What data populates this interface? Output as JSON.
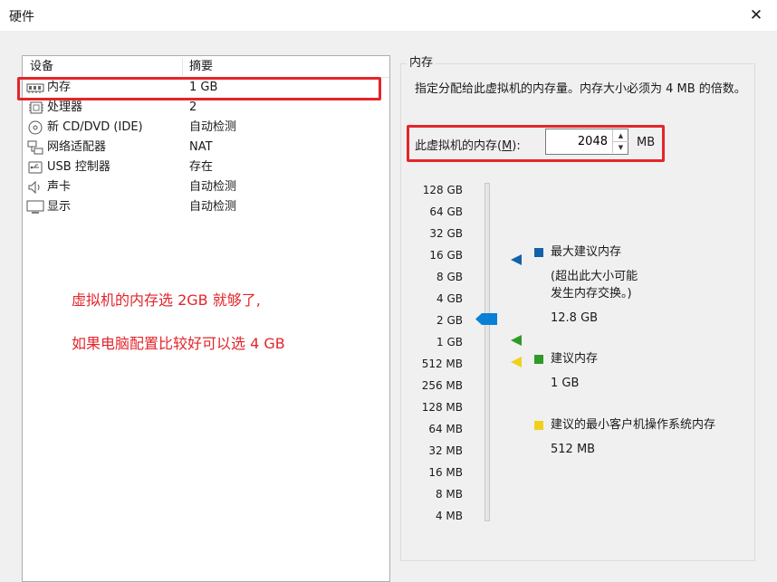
{
  "window": {
    "title": "硬件",
    "close_glyph": "✕"
  },
  "device_list": {
    "col_device": "设备",
    "col_summary": "摘要",
    "rows": [
      {
        "name": "内存",
        "summary": "1 GB",
        "icon": "memory-icon"
      },
      {
        "name": "处理器",
        "summary": "2",
        "icon": "processor-icon"
      },
      {
        "name": "新 CD/DVD (IDE)",
        "summary": "自动检测",
        "icon": "cd-dvd-icon"
      },
      {
        "name": "网络适配器",
        "summary": "NAT",
        "icon": "network-adapter-icon"
      },
      {
        "name": "USB 控制器",
        "summary": "存在",
        "icon": "usb-icon"
      },
      {
        "name": "声卡",
        "summary": "自动检测",
        "icon": "sound-card-icon"
      },
      {
        "name": "显示",
        "summary": "自动检测",
        "icon": "display-icon"
      }
    ]
  },
  "annotations": {
    "line1": "虚拟机的内存选 2GB 就够了,",
    "line2": "如果电脑配置比较好可以选 4 GB"
  },
  "memory": {
    "group_title": "内存",
    "description": "指定分配给此虚拟机的内存量。内存大小必须为 4 MB 的倍数。",
    "label_prefix": "此虚拟机的内存(",
    "label_hotkey": "M",
    "label_suffix": "):",
    "value": "2048",
    "unit": "MB",
    "scale": [
      "128 GB",
      "64 GB",
      "32 GB",
      "16 GB",
      "8 GB",
      "4 GB",
      "2 GB",
      "1 GB",
      "512 MB",
      "256 MB",
      "128 MB",
      "64 MB",
      "32 MB",
      "16 MB",
      "8 MB",
      "4 MB"
    ],
    "slider_value": "2 GB",
    "legend": {
      "max_title": "最大建议内存",
      "max_note_1": "(超出此大小可能",
      "max_note_2": "发生内存交换。)",
      "max_value": "12.8 GB",
      "rec_title": "建议内存",
      "rec_value": "1 GB",
      "min_title": "建议的最小客户机操作系统内存",
      "min_value": "512 MB"
    },
    "colors": {
      "max": "#1461a8",
      "recommended": "#2f9a26",
      "minimum": "#f0d11a",
      "thumb": "#0a7fd6",
      "highlight": "#e3252b"
    }
  }
}
